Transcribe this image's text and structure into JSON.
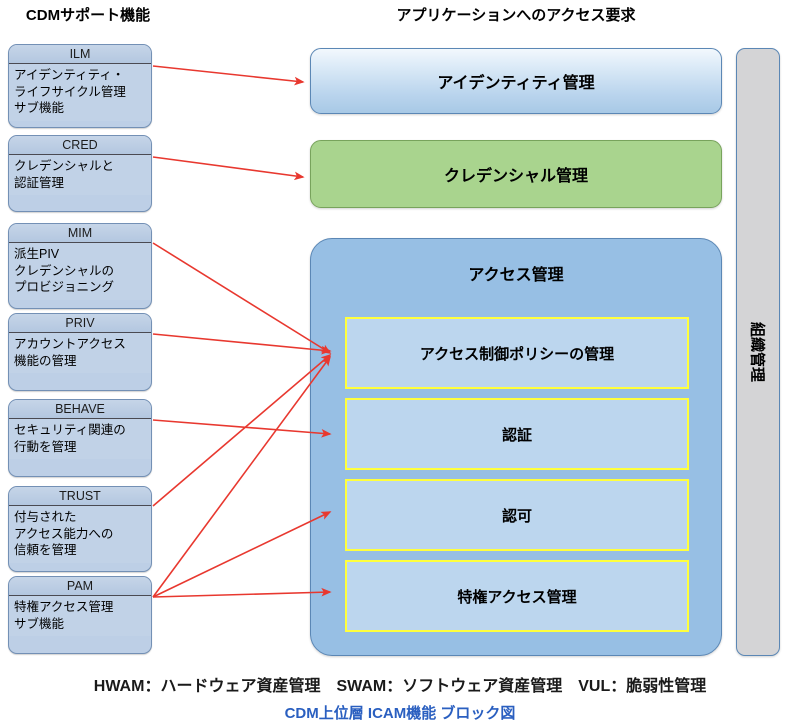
{
  "headers": {
    "left": "CDMサポート機能",
    "right": "アプリケーションへのアクセス要求"
  },
  "support_functions": [
    {
      "code": "ILM",
      "lines": [
        "アイデンティティ・",
        "ライフサイクル管理",
        "サブ機能"
      ]
    },
    {
      "code": "CRED",
      "lines": [
        "クレデンシャルと",
        "認証管理"
      ]
    },
    {
      "code": "MIM",
      "lines": [
        "派生PIV",
        "クレデンシャルの",
        "プロビジョニング"
      ]
    },
    {
      "code": "PRIV",
      "lines": [
        "アカウントアクセス",
        "機能の管理"
      ]
    },
    {
      "code": "BEHAVE",
      "lines": [
        "セキュリティ関連の",
        "行動を管理"
      ]
    },
    {
      "code": "TRUST",
      "lines": [
        "付与された",
        "アクセス能力への",
        "信頼を管理"
      ]
    },
    {
      "code": "PAM",
      "lines": [
        "特権アクセス管理",
        "サブ機能"
      ]
    }
  ],
  "capabilities": {
    "identity_management": "アイデンティティ管理",
    "credential_management": "クレデンシャル管理",
    "access_management": "アクセス管理",
    "organization_management": "組織管理",
    "access_subfunctions": [
      "アクセス制御ポリシーの管理",
      "認証",
      "認可",
      "特権アクセス管理"
    ]
  },
  "footer": {
    "legend": "HWAM：ハードウェア資産管理　SWAM：ソフトウェア資産管理　VUL：脆弱性管理",
    "caption": "CDM上位層 ICAM機能 ブロック図"
  },
  "colors": {
    "arrow": "#e8382f",
    "card_fill": "#bdcfe6",
    "card_border": "#7390b5",
    "identity_fill": "#cde2f4",
    "credential_fill": "#a9d48e",
    "access_fill": "#97bfe4",
    "subbox_fill": "#bcd6ee",
    "subbox_border": "#ffff3d",
    "org_fill": "#d4d4d6",
    "caption_color": "#2a5fc0"
  }
}
